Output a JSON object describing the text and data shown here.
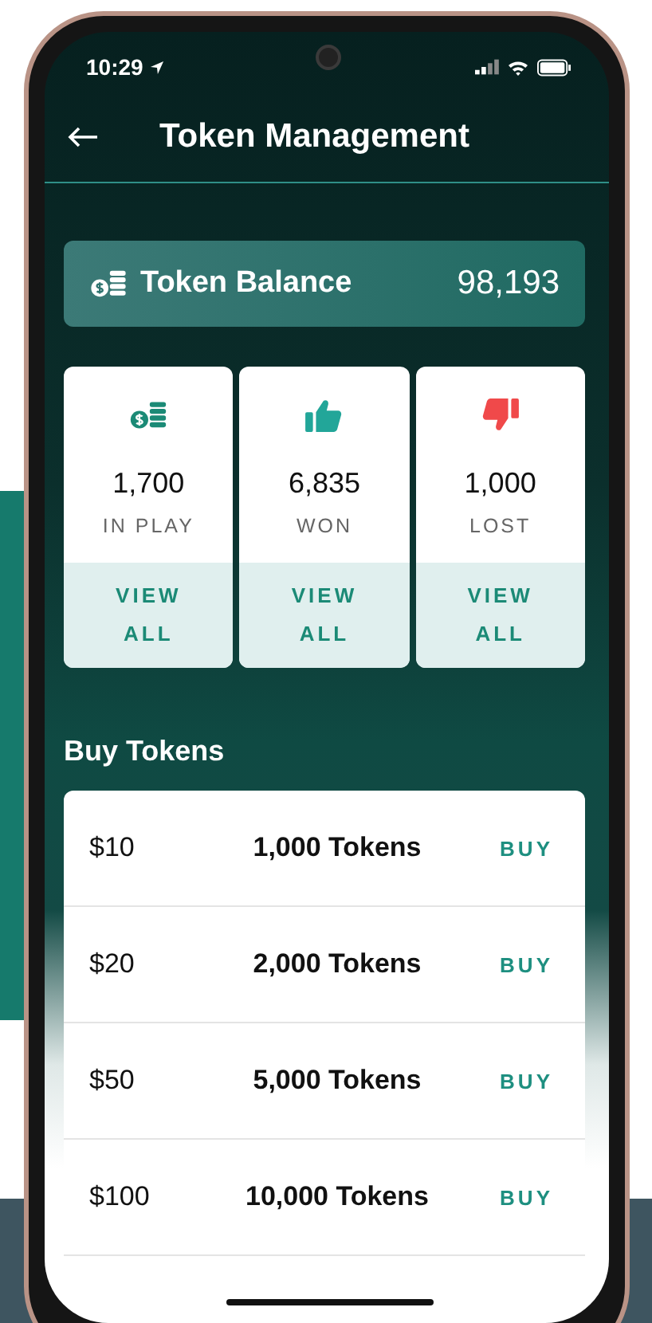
{
  "status_bar": {
    "time": "10:29"
  },
  "header": {
    "title": "Token Management"
  },
  "balance": {
    "label": "Token Balance",
    "value": "98,193"
  },
  "stats": [
    {
      "kind": "coins",
      "value": "1,700",
      "label": "IN PLAY",
      "action": "VIEW ALL"
    },
    {
      "kind": "won",
      "value": "6,835",
      "label": "WON",
      "action": "VIEW ALL"
    },
    {
      "kind": "lost",
      "value": "1,000",
      "label": "LOST",
      "action": "VIEW ALL"
    }
  ],
  "buy_section": {
    "title": "Buy Tokens",
    "packages": [
      {
        "price": "$10",
        "tokens": "1,000 Tokens",
        "action": "BUY"
      },
      {
        "price": "$20",
        "tokens": "2,000 Tokens",
        "action": "BUY"
      },
      {
        "price": "$50",
        "tokens": "5,000 Tokens",
        "action": "BUY"
      },
      {
        "price": "$100",
        "tokens": "10,000 Tokens",
        "action": "BUY"
      }
    ]
  }
}
